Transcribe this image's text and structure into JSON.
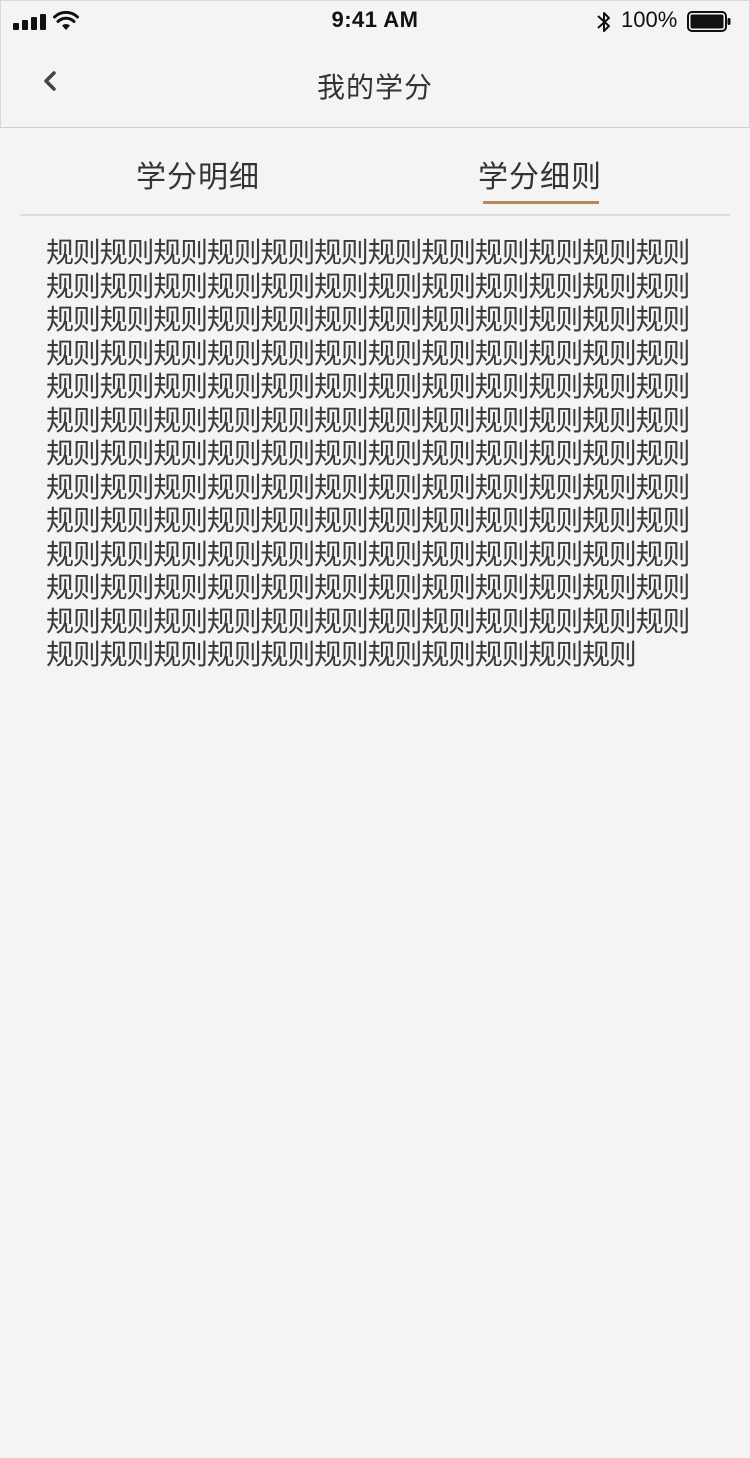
{
  "status_bar": {
    "time": "9:41 AM",
    "battery_percent": "100%",
    "icons": [
      "signal-icon",
      "wifi-icon",
      "bluetooth-icon",
      "battery-icon"
    ]
  },
  "nav": {
    "title": "我的学分",
    "back_icon": "chevron-left-icon"
  },
  "tabs": [
    {
      "label": "学分明细",
      "active": false
    },
    {
      "label": "学分细则",
      "active": true
    }
  ],
  "content": {
    "rules_text": "规则规则规则规则规则规则规则规则规则规则规则规则规则规则规则规则规则规则规则规则规则规则规则规则规则规则规则规则规则规则规则规则规则规则规则规则规则规则规则规则规则规则规则规则规则规则规则规则规则规则规则规则规则规则规则规则规则规则规则规则规则规则规则规则规则规则规则规则规则规则规则规则规则规则规则规则规则规则规则规则规则规则规则规则规则规则规则规则规则规则规则规则规则规则规则规则规则规则规则规则规则规则规则规则规则规则规则规则规则规则规则规则规则规则规则规则规则规则规则规则规则规则规则规则规则规则规则规则规则规则规则规则规则规则规则规则规则规则规则规则规则规则规则规则规则规则规则规则规则规则规则规则规则规则规则"
  },
  "colors": {
    "background": "#f4f4f4",
    "text": "#333333",
    "accent_underline": "#b9875a",
    "divider": "#dcdcdc"
  }
}
